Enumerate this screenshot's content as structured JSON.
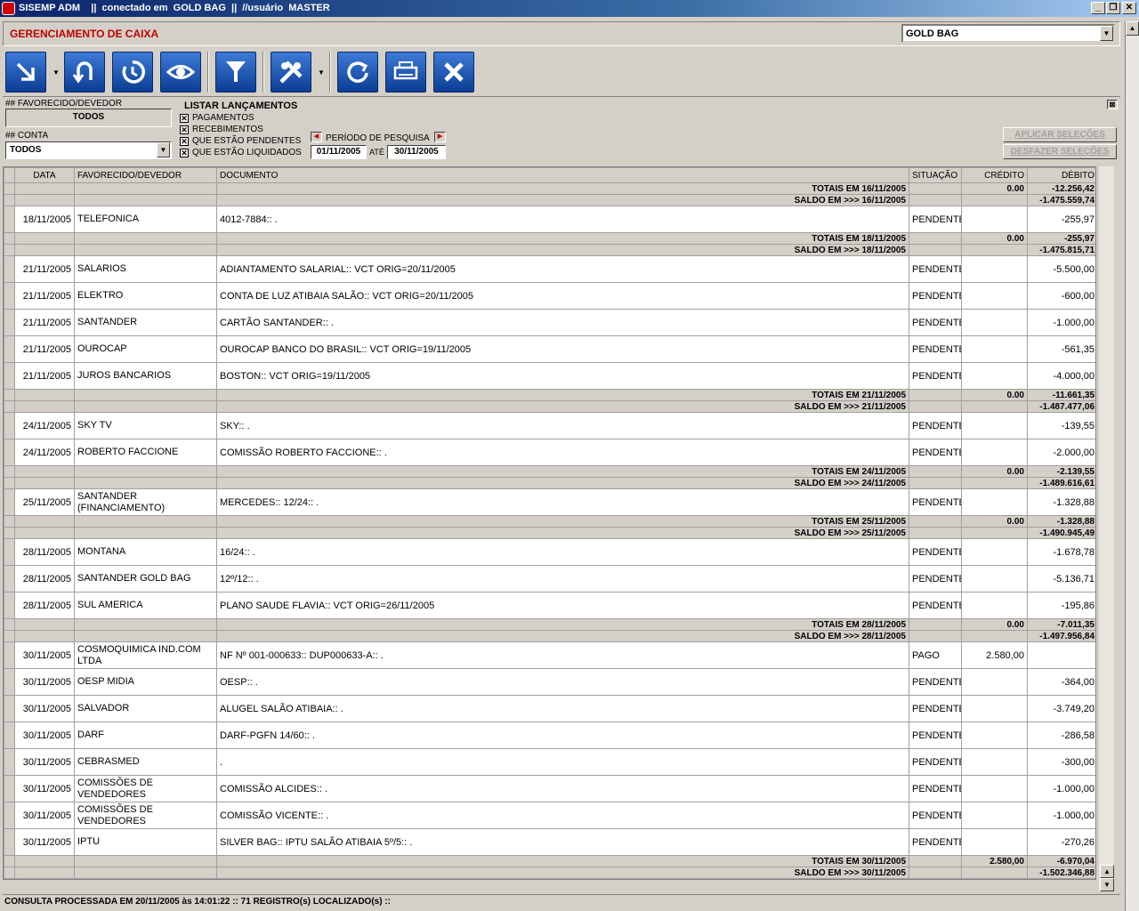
{
  "window": {
    "title": "SISEMP ADM    ||  conectado em  GOLD BAG  ||  //usuário  MASTER",
    "min": "_",
    "restore": "❐",
    "close": "✕"
  },
  "header": {
    "title": "GERENCIAMENTO DE CAIXA",
    "company": "GOLD BAG"
  },
  "toolbar": [
    {
      "name": "import-button",
      "icon": "arrow-down-right-icon"
    },
    {
      "name": "undo-button",
      "icon": "undo-arrow-icon"
    },
    {
      "name": "history-button",
      "icon": "history-icon"
    },
    {
      "name": "view-button",
      "icon": "eye-icon"
    },
    {
      "name": "filter-button",
      "icon": "funnel-icon"
    },
    {
      "name": "tools-button",
      "icon": "tools-icon"
    },
    {
      "name": "refresh-button",
      "icon": "refresh-icon"
    },
    {
      "name": "print-button",
      "icon": "printer-icon"
    },
    {
      "name": "close-button",
      "icon": "x-icon"
    }
  ],
  "filters": {
    "favorecido_label": "## FAVORECIDO/DEVEDOR",
    "favorecido_value": "TODOS",
    "conta_label": "## CONTA",
    "conta_value": "TODOS",
    "listar_label": "LISTAR LANÇAMENTOS",
    "checks": [
      {
        "label": "PAGAMENTOS",
        "checked": true
      },
      {
        "label": "RECEBIMENTOS",
        "checked": true
      },
      {
        "label": "QUE ESTÃO PENDENTES",
        "checked": true
      },
      {
        "label": "QUE ESTÃO LIQUIDADOS",
        "checked": true
      }
    ],
    "periodo_label": "PERÍODO DE PESQUISA",
    "data_ini": "01/11/2005",
    "ate": "ATÉ",
    "data_fim": "30/11/2005",
    "aplicar": "APLICAR SELEÇÕES",
    "desfazer": "DESFAZER SELEÇÕES"
  },
  "columns": [
    "DATA",
    "FAVORECIDO/DEVEDOR",
    "DOCUMENTO",
    "SITUAÇÃO",
    "CRÉDITO",
    "DÉBITO"
  ],
  "rows": [
    {
      "t": "tot",
      "label": "TOTAIS EM 16/11/2005",
      "cred": "0.00",
      "deb": "-12.256,42"
    },
    {
      "t": "sal",
      "label": "SALDO EM >>> 16/11/2005",
      "deb": "-1.475.559,74"
    },
    {
      "t": "d",
      "data": "18/11/2005",
      "fav": "TELEFONICA",
      "doc": "4012-7884:: .",
      "sit": "PENDENTE",
      "cred": "",
      "deb": "-255,97"
    },
    {
      "t": "tot",
      "label": "TOTAIS EM 18/11/2005",
      "cred": "0.00",
      "deb": "-255,97"
    },
    {
      "t": "sal",
      "label": "SALDO EM >>> 18/11/2005",
      "deb": "-1.475.815,71"
    },
    {
      "t": "d",
      "data": "21/11/2005",
      "fav": "SALARIOS",
      "doc": "ADIANTAMENTO SALARIAL:: VCT ORIG=20/11/2005",
      "sit": "PENDENTE",
      "cred": "",
      "deb": "-5.500,00"
    },
    {
      "t": "d",
      "data": "21/11/2005",
      "fav": "ELEKTRO",
      "doc": "CONTA DE LUZ ATIBAIA SALÃO:: VCT ORIG=20/11/2005",
      "sit": "PENDENTE",
      "cred": "",
      "deb": "-600,00"
    },
    {
      "t": "d",
      "data": "21/11/2005",
      "fav": "SANTANDER",
      "doc": "CARTÃO SANTANDER:: .",
      "sit": "PENDENTE",
      "cred": "",
      "deb": "-1.000,00"
    },
    {
      "t": "d",
      "data": "21/11/2005",
      "fav": "OUROCAP",
      "doc": "OUROCAP BANCO DO BRASIL:: VCT ORIG=19/11/2005",
      "sit": "PENDENTE",
      "cred": "",
      "deb": "-561,35"
    },
    {
      "t": "d",
      "data": "21/11/2005",
      "fav": "JUROS BANCARIOS",
      "doc": "BOSTON:: VCT ORIG=19/11/2005",
      "sit": "PENDENTE",
      "cred": "",
      "deb": "-4.000,00"
    },
    {
      "t": "tot",
      "label": "TOTAIS EM 21/11/2005",
      "cred": "0.00",
      "deb": "-11.661,35"
    },
    {
      "t": "sal",
      "label": "SALDO EM >>> 21/11/2005",
      "deb": "-1.487.477,06"
    },
    {
      "t": "d",
      "data": "24/11/2005",
      "fav": "SKY TV",
      "doc": "SKY:: .",
      "sit": "PENDENTE",
      "cred": "",
      "deb": "-139,55"
    },
    {
      "t": "d",
      "data": "24/11/2005",
      "fav": "ROBERTO FACCIONE",
      "doc": "COMISSÃO ROBERTO FACCIONE:: .",
      "sit": "PENDENTE",
      "cred": "",
      "deb": "-2.000,00"
    },
    {
      "t": "tot",
      "label": "TOTAIS EM 24/11/2005",
      "cred": "0.00",
      "deb": "-2.139,55"
    },
    {
      "t": "sal",
      "label": "SALDO EM >>> 24/11/2005",
      "deb": "-1.489.616,61"
    },
    {
      "t": "d",
      "data": "25/11/2005",
      "fav": "SANTANDER (FINANCIAMENTO)",
      "doc": "MERCEDES:: 12/24:: .",
      "sit": "PENDENTE",
      "cred": "",
      "deb": "-1.328,88"
    },
    {
      "t": "tot",
      "label": "TOTAIS EM 25/11/2005",
      "cred": "0.00",
      "deb": "-1.328,88"
    },
    {
      "t": "sal",
      "label": "SALDO EM >>> 25/11/2005",
      "deb": "-1.490.945,49"
    },
    {
      "t": "d",
      "data": "28/11/2005",
      "fav": "MONTANA",
      "doc": "16/24:: .",
      "sit": "PENDENTE",
      "cred": "",
      "deb": "-1.678,78"
    },
    {
      "t": "d",
      "data": "28/11/2005",
      "fav": "SANTANDER GOLD BAG",
      "doc": "12º/12:: .",
      "sit": "PENDENTE",
      "cred": "",
      "deb": "-5.136,71"
    },
    {
      "t": "d",
      "data": "28/11/2005",
      "fav": "SUL AMERICA",
      "doc": "PLANO SAUDE FLAVIA:: VCT ORIG=26/11/2005",
      "sit": "PENDENTE",
      "cred": "",
      "deb": "-195,86"
    },
    {
      "t": "tot",
      "label": "TOTAIS EM 28/11/2005",
      "cred": "0.00",
      "deb": "-7.011,35"
    },
    {
      "t": "sal",
      "label": "SALDO EM >>> 28/11/2005",
      "deb": "-1.497.956,84"
    },
    {
      "t": "d",
      "data": "30/11/2005",
      "fav": "COSMOQUIMICA IND.COM LTDA",
      "doc": "NF Nº 001-000633:: DUP000633-A:: .",
      "sit": "PAGO",
      "cred": "2.580,00",
      "deb": ""
    },
    {
      "t": "d",
      "data": "30/11/2005",
      "fav": "OESP  MIDIA",
      "doc": "OESP:: .",
      "sit": "PENDENTE",
      "cred": "",
      "deb": "-364,00"
    },
    {
      "t": "d",
      "data": "30/11/2005",
      "fav": "SALVADOR",
      "doc": "ALUGEL SALÃO ATIBAIA:: .",
      "sit": "PENDENTE",
      "cred": "",
      "deb": "-3.749,20"
    },
    {
      "t": "d",
      "data": "30/11/2005",
      "fav": "DARF",
      "doc": "DARF-PGFN 14/60:: .",
      "sit": "PENDENTE",
      "cred": "",
      "deb": "-286,58"
    },
    {
      "t": "d",
      "data": "30/11/2005",
      "fav": "CEBRASMED",
      "doc": ".",
      "sit": "PENDENTE",
      "cred": "",
      "deb": "-300,00"
    },
    {
      "t": "d",
      "data": "30/11/2005",
      "fav": "COMISSÕES DE VENDEDORES",
      "doc": "COMISSÃO ALCIDES:: .",
      "sit": "PENDENTE",
      "cred": "",
      "deb": "-1.000,00"
    },
    {
      "t": "d",
      "data": "30/11/2005",
      "fav": "COMISSÕES DE VENDEDORES",
      "doc": "COMISSÃO VICENTE:: .",
      "sit": "PENDENTE",
      "cred": "",
      "deb": "-1.000,00"
    },
    {
      "t": "d",
      "data": "30/11/2005",
      "fav": "IPTU",
      "doc": "SILVER BAG:: IPTU SALÃO ATIBAIA 5º/5:: .",
      "sit": "PENDENTE",
      "cred": "",
      "deb": "-270,26"
    },
    {
      "t": "tot",
      "label": "TOTAIS EM 30/11/2005",
      "cred": "2.580,00",
      "deb": "-6.970,04"
    },
    {
      "t": "sal",
      "label": "SALDO EM >>> 30/11/2005",
      "deb": "-1.502.346,88"
    }
  ],
  "status": "CONSULTA PROCESSADA EM 20/11/2005 às 14:01:22 :: 71 REGISTRO(s) LOCALIZADO(s) ::"
}
